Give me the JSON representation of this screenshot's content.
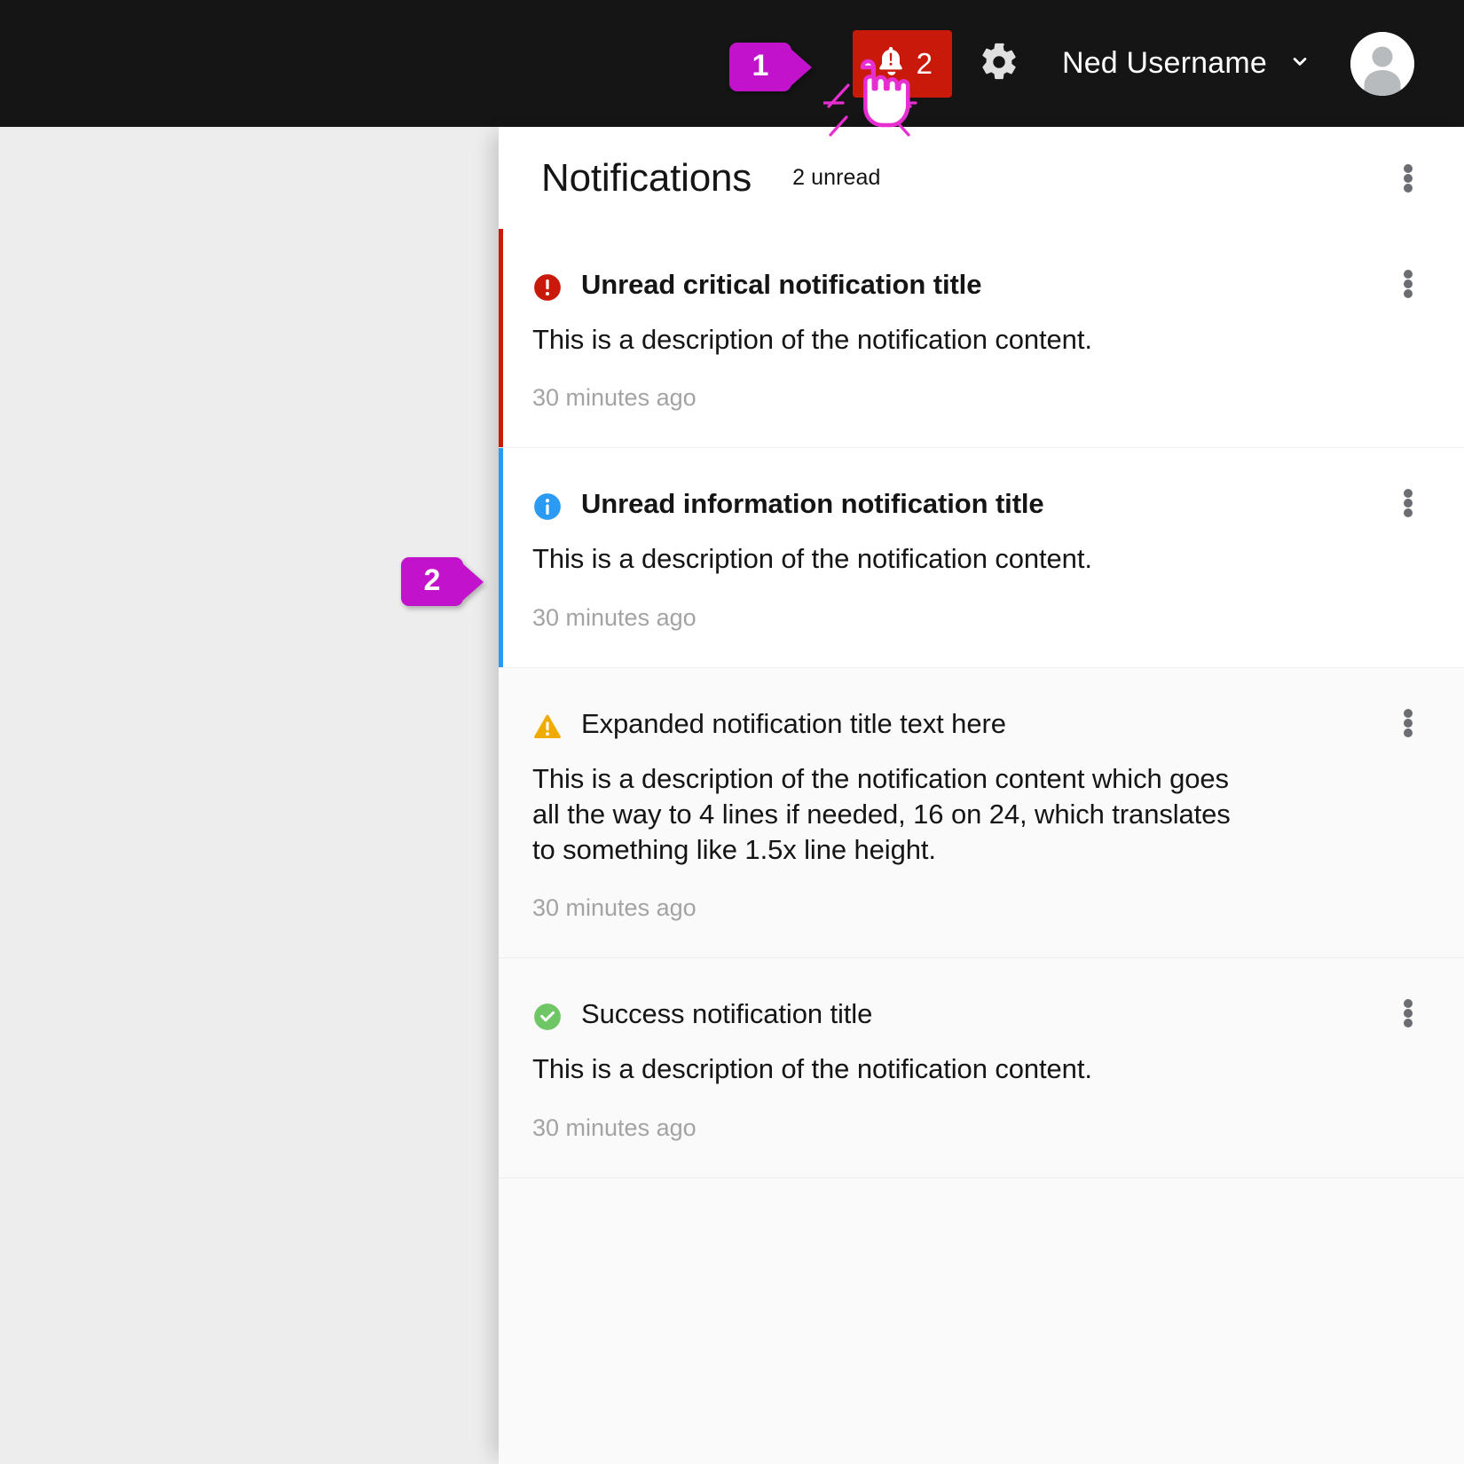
{
  "masthead": {
    "notifications_button": {
      "icon": "bell-with-exclamation-icon",
      "count": "2",
      "background_color": "#c9190b",
      "state": "active"
    },
    "settings_button": {
      "icon": "gear-icon"
    },
    "user_menu": {
      "name": "Ned Username",
      "caret_icon": "chevron-down-icon",
      "avatar_icon": "user-avatar-icon"
    },
    "background_color": "#151515"
  },
  "callouts": [
    {
      "label": "1",
      "target": "notifications-bell-button",
      "color": "#c312cc"
    },
    {
      "label": "2",
      "target": "notification-drawer",
      "color": "#c312cc"
    }
  ],
  "drawer": {
    "title": "Notifications",
    "unread_label": "2 unread",
    "header_kebab_icon": "kebab-menu-icon",
    "notifications": [
      {
        "variant": "critical",
        "icon": "exclamation-circle-icon",
        "accent_color": "#c9190b",
        "read": false,
        "title": "Unread critical notification title",
        "description": "This is a description of the notification content.",
        "time": "30 minutes ago",
        "kebab_icon": "kebab-menu-icon"
      },
      {
        "variant": "info",
        "icon": "info-circle-icon",
        "accent_color": "#2b9af3",
        "read": false,
        "title": "Unread information notification title",
        "description": "This is a description of the notification content.",
        "time": "30 minutes ago",
        "kebab_icon": "kebab-menu-icon"
      },
      {
        "variant": "warning",
        "icon": "exclamation-triangle-icon",
        "accent_color": "#f0ab00",
        "read": true,
        "title": "Expanded notification title text here",
        "description": "This is a description of the notification content which goes all the way to 4 lines if needed, 16 on 24, which translates to something like 1.5x line height.",
        "time": "30 minutes ago",
        "kebab_icon": "kebab-menu-icon"
      },
      {
        "variant": "success",
        "icon": "check-circle-icon",
        "accent_color": "#6ec664",
        "read": true,
        "title": "Success notification title",
        "description": "This is a description of the notification content.",
        "time": "30 minutes ago",
        "kebab_icon": "kebab-menu-icon"
      }
    ]
  }
}
